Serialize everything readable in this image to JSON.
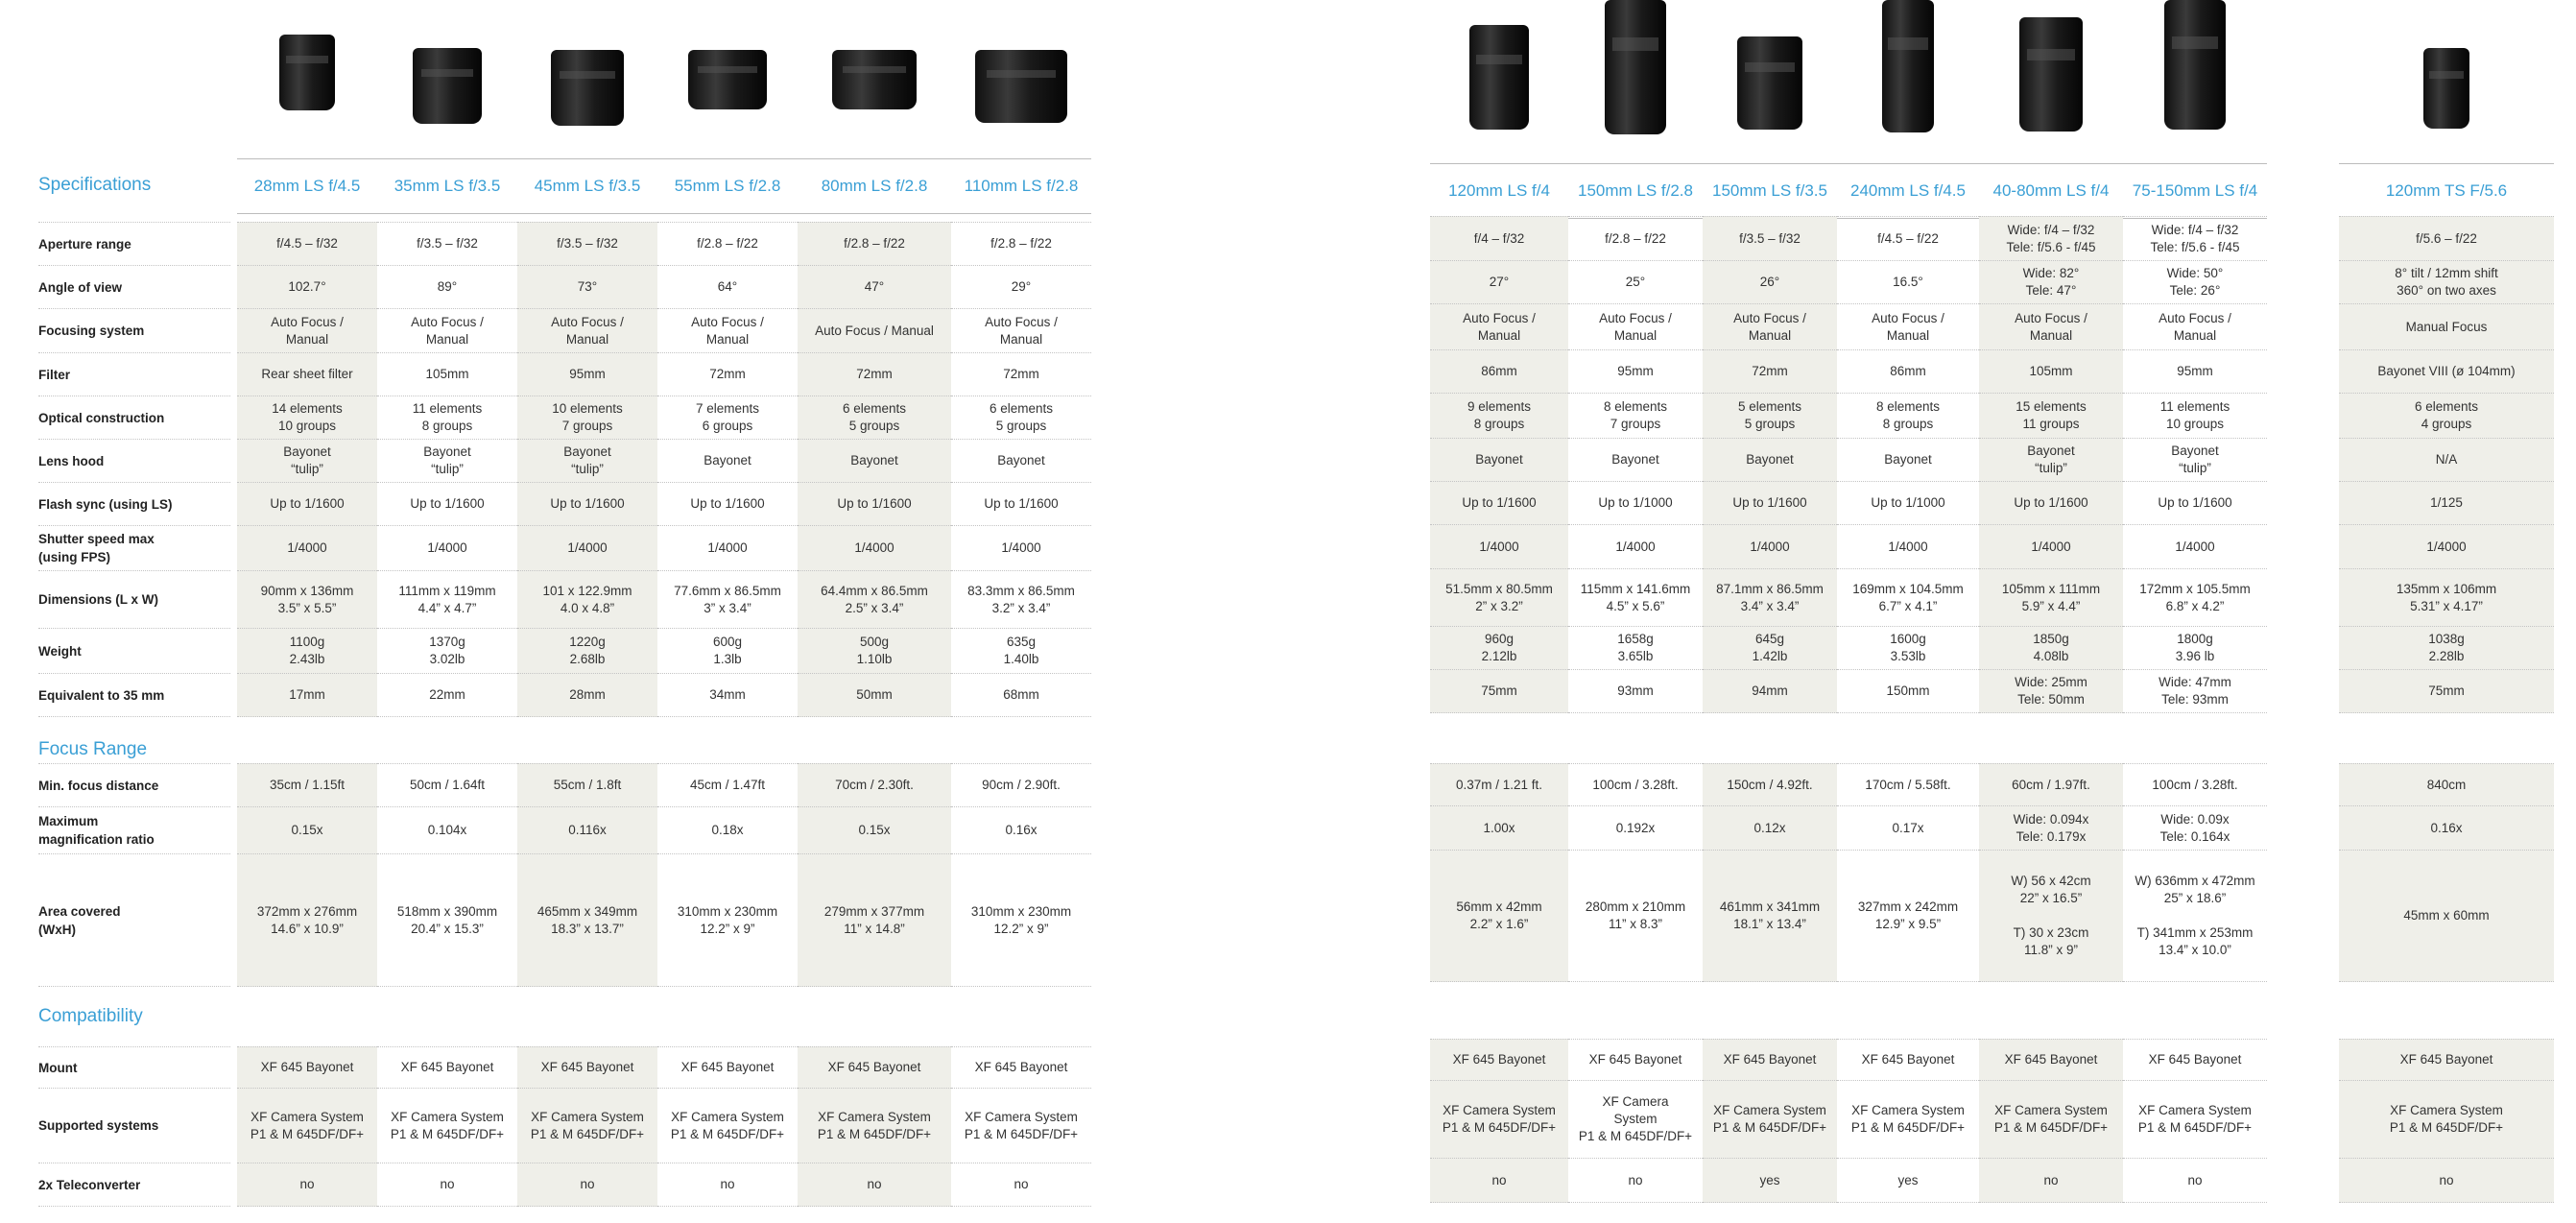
{
  "sections": {
    "specifications": "Specifications",
    "focus_range": "Focus Range",
    "compatibility": "Compatibility"
  },
  "row_labels": [
    "Aperture range",
    "Angle of view",
    "Focusing system",
    "Filter",
    "Optical construction",
    "Lens hood",
    "Flash sync  (using LS)",
    "Shutter speed max\n(using FPS)",
    "Dimensions (L x W)",
    "Weight",
    "Equivalent to 35 mm",
    "Min. focus distance",
    "Maximum\nmagnification ratio",
    "Area covered\n(WxH)",
    "Mount",
    "Supported systems",
    "2x Teleconverter"
  ],
  "lenses": [
    {
      "name": "28mm LS f/4.5",
      "shade": true,
      "values": [
        "f/4.5 – f/32",
        "102.7°",
        "Auto Focus /\nManual",
        "Rear sheet filter",
        "14 elements\n10 groups",
        "Bayonet\n“tulip”",
        "Up to 1/1600",
        "1/4000",
        "90mm x 136mm\n3.5” x 5.5”",
        "1100g\n2.43lb",
        "17mm",
        "35cm / 1.15ft",
        "0.15x",
        "372mm x 276mm\n14.6” x 10.9”",
        "XF 645 Bayonet",
        "XF Camera System\nP1 & M 645DF/DF+",
        "no"
      ]
    },
    {
      "name": "35mm LS f/3.5",
      "shade": false,
      "values": [
        "f/3.5 – f/32",
        "89°",
        "Auto Focus /\nManual",
        "105mm",
        "11 elements\n8 groups",
        "Bayonet\n“tulip”",
        "Up to 1/1600",
        "1/4000",
        "111mm x 119mm\n4.4” x 4.7”",
        "1370g\n3.02lb",
        "22mm",
        "50cm / 1.64ft",
        "0.104x",
        "518mm x 390mm\n20.4” x 15.3”",
        "XF 645 Bayonet",
        "XF Camera System\nP1 & M 645DF/DF+",
        "no"
      ]
    },
    {
      "name": "45mm LS f/3.5",
      "shade": true,
      "values": [
        "f/3.5 – f/32",
        "73°",
        "Auto Focus /\nManual",
        "95mm",
        "10 elements\n7 groups",
        "Bayonet\n“tulip”",
        "Up to 1/1600",
        "1/4000",
        "101 x 122.9mm\n4.0 x 4.8”",
        "1220g\n2.68lb",
        "28mm",
        "55cm / 1.8ft",
        "0.116x",
        "465mm x 349mm\n18.3” x 13.7”",
        "XF 645 Bayonet",
        "XF Camera System\nP1 & M 645DF/DF+",
        "no"
      ]
    },
    {
      "name": "55mm LS f/2.8",
      "shade": false,
      "values": [
        "f/2.8 – f/22",
        "64°",
        "Auto Focus /\nManual",
        "72mm",
        "7 elements\n6 groups",
        "Bayonet",
        "Up to 1/1600",
        "1/4000",
        "77.6mm x 86.5mm\n3” x 3.4”",
        "600g\n1.3lb",
        "34mm",
        "45cm / 1.47ft",
        "0.18x",
        "310mm x 230mm\n12.2” x 9”",
        "XF 645 Bayonet",
        "XF Camera System\nP1 & M 645DF/DF+",
        "no"
      ]
    },
    {
      "name": "80mm LS f/2.8",
      "shade": true,
      "values": [
        "f/2.8 – f/22",
        "47°",
        "Auto Focus / Manual",
        "72mm",
        "6 elements\n5 groups",
        "Bayonet",
        "Up to 1/1600",
        "1/4000",
        "64.4mm x 86.5mm\n2.5” x 3.4”",
        "500g\n1.10lb",
        "50mm",
        "70cm / 2.30ft.",
        "0.15x",
        "279mm x 377mm\n11” x 14.8”",
        "XF 645 Bayonet",
        "XF Camera System\nP1 & M 645DF/DF+",
        "no"
      ]
    },
    {
      "name": "110mm LS f/2.8",
      "shade": false,
      "values": [
        "f/2.8 – f/22",
        "29°",
        "Auto Focus /\nManual",
        "72mm",
        "6 elements\n5 groups",
        "Bayonet",
        "Up to 1/1600",
        "1/4000",
        "83.3mm x 86.5mm\n3.2” x 3.4”",
        "635g\n1.40lb",
        "68mm",
        "90cm / 2.90ft.",
        "0.16x",
        "310mm x 230mm\n12.2” x 9”",
        "XF 645 Bayonet",
        "XF Camera System\nP1 & M 645DF/DF+",
        "no"
      ]
    },
    {
      "name": "120mm LS f/4",
      "shade": true,
      "values": [
        "f/4 – f/32",
        "27°",
        "Auto Focus /\nManual",
        "86mm",
        "9 elements\n8 groups",
        "Bayonet",
        "Up to 1/1600",
        "1/4000",
        "51.5mm x 80.5mm\n2” x 3.2”",
        "960g\n2.12lb",
        "75mm",
        "0.37m / 1.21 ft.",
        "1.00x",
        "56mm x 42mm\n2.2” x 1.6”",
        "XF 645 Bayonet",
        "XF Camera System\nP1 & M 645DF/DF+",
        "no"
      ]
    },
    {
      "name": "150mm LS f/2.8",
      "shade": false,
      "values": [
        "f/2.8 – f/22",
        "25°",
        "Auto Focus /\nManual",
        "95mm",
        "8 elements\n7 groups",
        "Bayonet",
        "Up to 1/1000",
        "1/4000",
        "115mm x 141.6mm\n4.5” x 5.6”",
        "1658g\n3.65lb",
        "93mm",
        "100cm / 3.28ft.",
        "0.192x",
        "280mm x 210mm\n11” x 8.3”",
        "XF 645 Bayonet",
        "XF Camera\nSystem\nP1 & M 645DF/DF+",
        "no"
      ]
    },
    {
      "name": "150mm LS f/3.5",
      "shade": true,
      "values": [
        "f/3.5 – f/32",
        "26°",
        "Auto Focus /\nManual",
        "72mm",
        "5 elements\n5 groups",
        "Bayonet",
        "Up to 1/1600",
        "1/4000",
        "87.1mm x 86.5mm\n3.4” x 3.4”",
        "645g\n1.42lb",
        "94mm",
        "150cm / 4.92ft.",
        "0.12x",
        "461mm x 341mm\n18.1” x 13.4”",
        "XF 645 Bayonet",
        "XF Camera System\nP1 & M 645DF/DF+",
        "yes"
      ]
    },
    {
      "name": "240mm LS f/4.5",
      "shade": false,
      "values": [
        "f/4.5 – f/22",
        "16.5°",
        "Auto Focus /\nManual",
        "86mm",
        "8 elements\n8 groups",
        "Bayonet",
        "Up to 1/1000",
        "1/4000",
        "169mm x 104.5mm\n6.7” x 4.1”",
        "1600g\n3.53lb",
        "150mm",
        "170cm / 5.58ft.",
        "0.17x",
        "327mm x 242mm\n12.9” x 9.5”",
        "XF 645 Bayonet",
        "XF Camera System\nP1 & M 645DF/DF+",
        "yes"
      ]
    },
    {
      "name": "40-80mm LS f/4",
      "shade": true,
      "values": [
        "Wide: f/4 – f/32\nTele: f/5.6 - f/45",
        "Wide: 82°\nTele: 47°",
        "Auto Focus /\nManual",
        "105mm",
        "15 elements\n11 groups",
        "Bayonet\n“tulip”",
        "Up to 1/1600",
        "1/4000",
        "105mm x 111mm\n5.9” x 4.4”",
        "1850g\n4.08lb",
        "Wide: 25mm\nTele: 50mm",
        "60cm / 1.97ft.",
        "Wide: 0.094x\nTele: 0.179x",
        "W) 56 x 42cm\n22” x 16.5”\n\nT) 30 x 23cm\n11.8” x 9”",
        "XF 645 Bayonet",
        "XF Camera System\nP1 & M 645DF/DF+",
        "no"
      ]
    },
    {
      "name": "75-150mm LS f/4",
      "shade": false,
      "values": [
        "Wide: f/4 – f/32\nTele: f/5.6 - f/45",
        "Wide: 50°\nTele: 26°",
        "Auto Focus /\nManual",
        "95mm",
        "11 elements\n10 groups",
        "Bayonet\n“tulip”",
        "Up to 1/1600",
        "1/4000",
        "172mm x 105.5mm\n6.8” x 4.2”",
        "1800g\n3.96 lb",
        "Wide: 47mm\nTele: 93mm",
        "100cm / 3.28ft.",
        "Wide: 0.09x\nTele: 0.164x",
        "W) 636mm x 472mm\n25” x 18.6”\n\nT) 341mm x 253mm\n13.4” x 10.0”",
        "XF 645 Bayonet",
        "XF Camera System\nP1 & M 645DF/DF+",
        "no"
      ]
    },
    {
      "name": "120mm TS F/5.6",
      "shade": true,
      "values": [
        "f/5.6 – f/22",
        "8° tilt / 12mm shift\n360° on two axes",
        "Manual Focus",
        "Bayonet VIII (ø 104mm)",
        "6 elements\n4 groups",
        "N/A",
        "1/125",
        "1/4000",
        "135mm x 106mm\n5.31” x 4.17”",
        "1038g\n2.28lb",
        "75mm",
        "840cm",
        "0.16x",
        "45mm x 60mm",
        "XF 645 Bayonet",
        "XF Camera System\nP1 & M 645DF/DF+",
        "no"
      ]
    }
  ]
}
